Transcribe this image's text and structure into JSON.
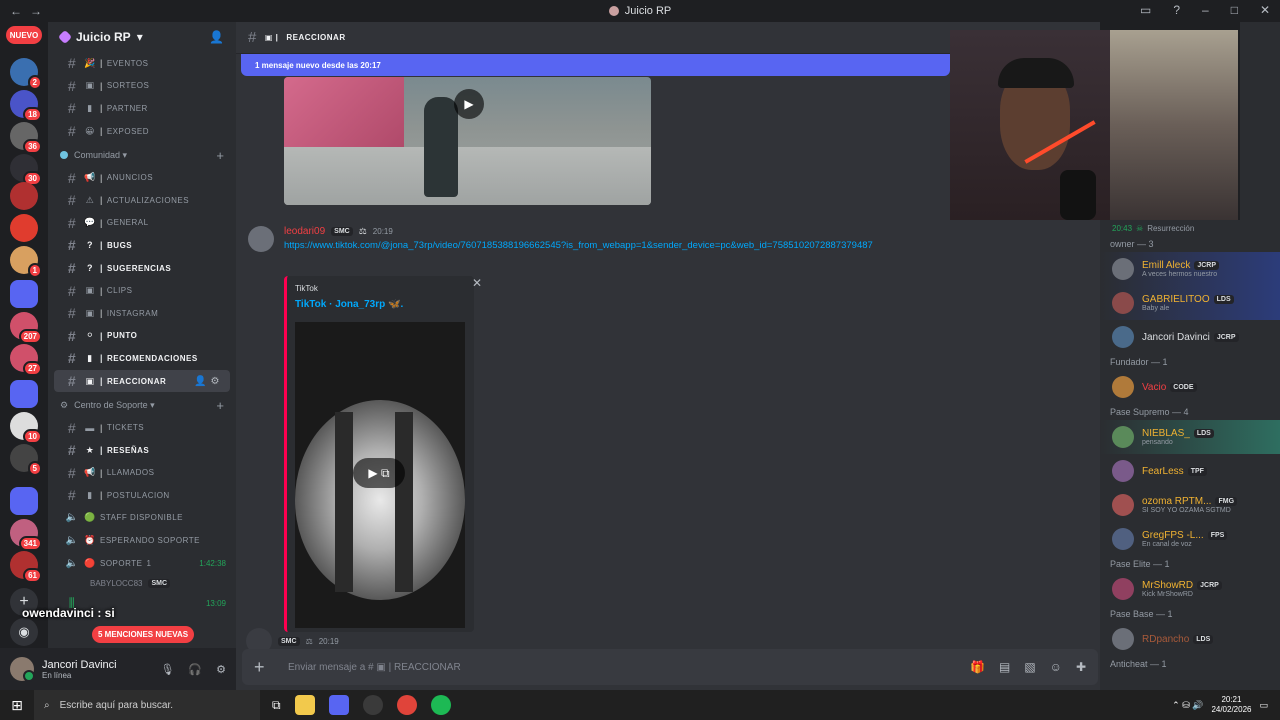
{
  "window": {
    "title": "Juicio RP"
  },
  "guilds": {
    "nuevo_label": "NUEVO",
    "badges": [
      "2",
      "18",
      "36",
      "30",
      "1",
      "207",
      "27",
      "10",
      "5",
      "341",
      "61"
    ]
  },
  "server": {
    "name": "Juicio RP"
  },
  "channels_top": [
    {
      "emoji": "🎉",
      "name": "EVENTOS"
    },
    {
      "emoji": "▣",
      "name": "SORTEOS"
    },
    {
      "emoji": "▮",
      "name": "PARTNER"
    },
    {
      "emoji": "😀",
      "name": "EXPOSED"
    }
  ],
  "category_comunidad": "Comunidad",
  "channels_comunidad": [
    {
      "emoji": "📢",
      "name": "ANUNCIOS",
      "bold": false
    },
    {
      "emoji": "⚠",
      "name": "ACTUALIZACIONES",
      "bold": false
    },
    {
      "emoji": "💬",
      "name": "GENERAL",
      "bold": false
    },
    {
      "emoji": "?",
      "name": "BUGS",
      "bold": true
    },
    {
      "emoji": "?",
      "name": "SUGERENCIAS",
      "bold": true
    },
    {
      "emoji": "▣",
      "name": "CLIPS",
      "bold": false
    },
    {
      "emoji": "▣",
      "name": "INSTAGRAM",
      "bold": false
    },
    {
      "emoji": "⚪",
      "name": "PUNTO",
      "bold": true
    },
    {
      "emoji": "▮",
      "name": "RECOMENDACIONES",
      "bold": true
    },
    {
      "emoji": "▣",
      "name": "REACCIONAR",
      "bold": true,
      "active": true
    }
  ],
  "category_soporte": "Centro de Soporte",
  "channels_soporte": [
    {
      "emoji": "▬",
      "name": "TICKETS",
      "bold": false
    },
    {
      "emoji": "★",
      "name": "RESEÑAS",
      "bold": true
    },
    {
      "emoji": "📢",
      "name": "LLAMADOS",
      "bold": false
    },
    {
      "emoji": "▮",
      "name": "POSTULACION",
      "bold": false
    }
  ],
  "voice_channels": [
    {
      "emoji": "🟢",
      "name": "STAFF DISPONIBLE"
    },
    {
      "emoji": "⏰",
      "name": "ESPERANDO SOPORTE"
    },
    {
      "emoji": "🔴",
      "name": "SOPORTE",
      "count": "1",
      "time": "1:42:38"
    }
  ],
  "voice_user": {
    "name": "BABYLOCC83",
    "tag": "SMC"
  },
  "voice_last_time": "13:09",
  "overlay_chat": "owendavinci : si",
  "mentions_pill": "5 MENCIONES NUEVAS",
  "user_panel": {
    "name": "Jancori Davinci",
    "status": "En línea"
  },
  "channel_header": {
    "name": "REACCIONAR"
  },
  "new_messages_bar": "1 mensaje nuevo desde las 20:17",
  "message": {
    "author": "leodari09",
    "tag": "SMC",
    "time": "20:19",
    "link": "https://www.tiktok.com/@jona_73rp/video/7607185388196662545?is_from_webapp=1&sender_device=pc&web_id=7585102072887379487"
  },
  "embed": {
    "provider": "TikTok",
    "title": "TikTok · Jona_73rp 🦋."
  },
  "message2": {
    "tag": "SMC",
    "time": "20:19"
  },
  "input": {
    "placeholder": "Enviar mensaje a #",
    "channel": "REACCIONAR"
  },
  "members": {
    "status_time": "20:43",
    "status_text": "Resurrección",
    "groups": [
      {
        "label": "owner — 3",
        "items": [
          {
            "name": "Emill Aleck",
            "tag": "JCRP",
            "sub": "A veces hermos nuestro",
            "color": "#f0b232",
            "hl": "hl2"
          },
          {
            "name": "GABRIELITOO",
            "tag": "LDS",
            "sub": "Baby ale",
            "color": "#f0b232",
            "hl": "hl2"
          },
          {
            "name": "Jancori Davinci",
            "tag": "JCRP",
            "sub": "",
            "color": "#dbdee1",
            "hl": ""
          }
        ]
      },
      {
        "label": "Fundador — 1",
        "items": [
          {
            "name": "Vacio",
            "tag": "CODE",
            "sub": "",
            "color": "#f23f43",
            "hl": ""
          }
        ]
      },
      {
        "label": "Pase Supremo — 4",
        "items": [
          {
            "name": "NIEBLAS_",
            "tag": "LDS",
            "sub": "pensando",
            "color": "#f0b232",
            "hl": "hl"
          },
          {
            "name": "FearLess",
            "tag": "TPF",
            "sub": "",
            "color": "#f0b232",
            "hl": ""
          },
          {
            "name": "ozoma RPTM...",
            "tag": "FMG",
            "sub": "SI SOY YO OZAMA SGTMD",
            "color": "#f0b232",
            "hl": ""
          },
          {
            "name": "GregFPS -L...",
            "tag": "FPS",
            "sub": "En canal de voz",
            "color": "#f0b232",
            "hl": ""
          }
        ]
      },
      {
        "label": "Pase Elite — 1",
        "items": [
          {
            "name": "MrShowRD",
            "tag": "JCRP",
            "sub": "Kick MrShowRD",
            "color": "#f0b232",
            "hl": ""
          }
        ]
      },
      {
        "label": "Pase Base — 1",
        "items": [
          {
            "name": "RDpancho",
            "tag": "LDS",
            "sub": "",
            "color": "#a85a3a",
            "hl": ""
          }
        ]
      },
      {
        "label": "Anticheat — 1",
        "items": []
      }
    ]
  },
  "taskbar": {
    "search_placeholder": "Escribe aquí para buscar.",
    "time": "20:21",
    "date": "24/02/2026"
  }
}
